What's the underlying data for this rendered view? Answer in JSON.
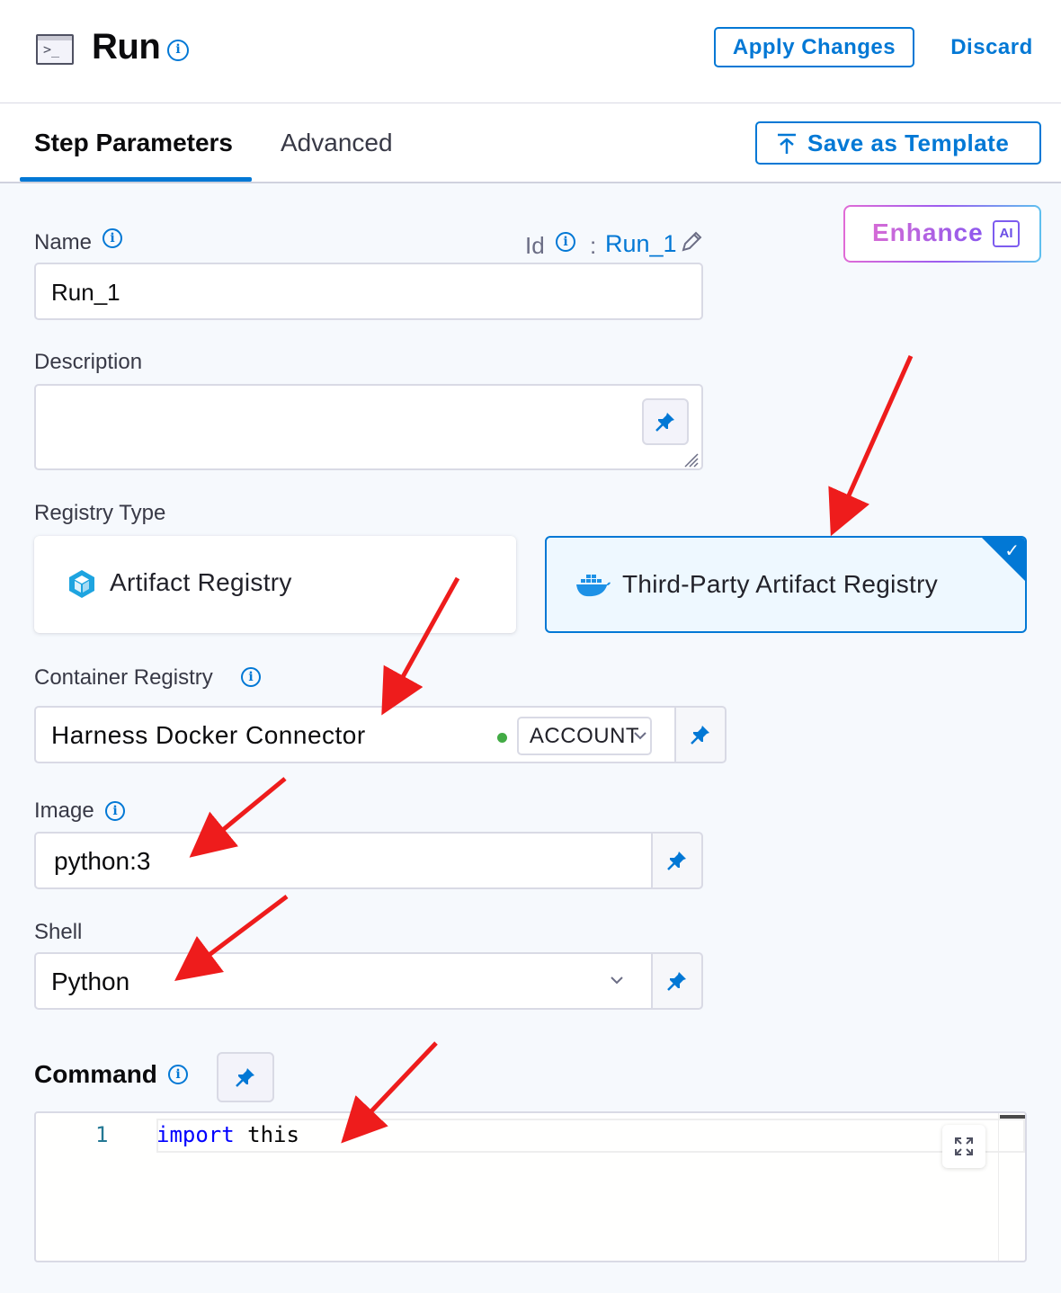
{
  "header": {
    "icon": "terminal-icon",
    "icon_glyph": ">_",
    "title": "Run",
    "apply_label": "Apply Changes",
    "discard_label": "Discard"
  },
  "tabs": {
    "items": [
      {
        "label": "Step Parameters",
        "active": true
      },
      {
        "label": "Advanced",
        "active": false
      }
    ],
    "save_template_label": "Save as Template"
  },
  "enhance": {
    "label": "Enhance",
    "ai_badge": "AI"
  },
  "form": {
    "name": {
      "label": "Name",
      "value": "Run_1"
    },
    "id": {
      "label": "Id",
      "separator": ":",
      "value": "Run_1"
    },
    "description": {
      "label": "Description",
      "value": ""
    },
    "registry_type": {
      "label": "Registry Type",
      "options": [
        {
          "label": "Artifact Registry",
          "icon": "artifact-registry-icon",
          "selected": false
        },
        {
          "label": "Third-Party Artifact Registry",
          "icon": "docker-icon",
          "selected": true
        }
      ]
    },
    "container_registry": {
      "label": "Container Registry",
      "value": "Harness Docker Connector",
      "scope_badge": "ACCOUNT",
      "status_color": "#42ab45"
    },
    "image": {
      "label": "Image",
      "value": "python:3"
    },
    "shell": {
      "label": "Shell",
      "value": "Python"
    },
    "command": {
      "label": "Command",
      "line_number": "1",
      "code_keyword": "import",
      "code_rest": " this"
    }
  },
  "colors": {
    "primary": "#0278d5",
    "annotation_arrow": "#ee1c1c",
    "selected_card_bg": "#eef8ff"
  }
}
